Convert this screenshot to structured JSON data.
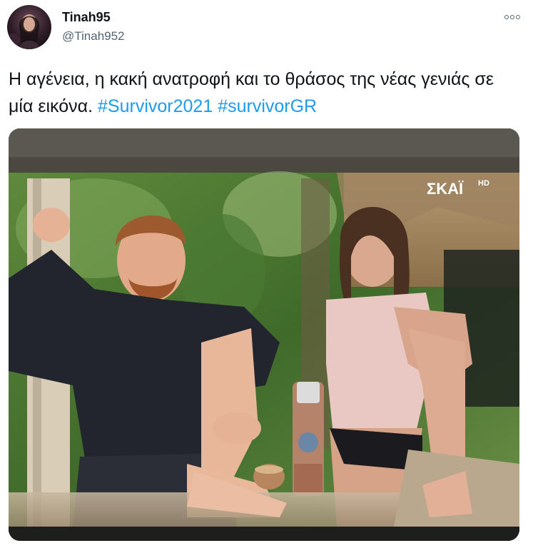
{
  "author": {
    "display_name": "Tinah95",
    "handle": "@Tinah952",
    "avatar_icon": "profile-photo"
  },
  "menu": {
    "icon": "more-horizontal-icon"
  },
  "tweet": {
    "text_before": "Η αγένεια, η κακή ανατροφή και το θράσος της νέας γενιάς σε μία εικόνα.",
    "hashtags": [
      "#Survivor2021",
      "#survivorGR"
    ]
  },
  "media": {
    "channel_logo": "ΣΚΑΪ",
    "channel_logo_hd": "HD"
  },
  "colors": {
    "hashtag": "#1d9bf0",
    "text": "#0f1419",
    "secondary": "#536471"
  }
}
